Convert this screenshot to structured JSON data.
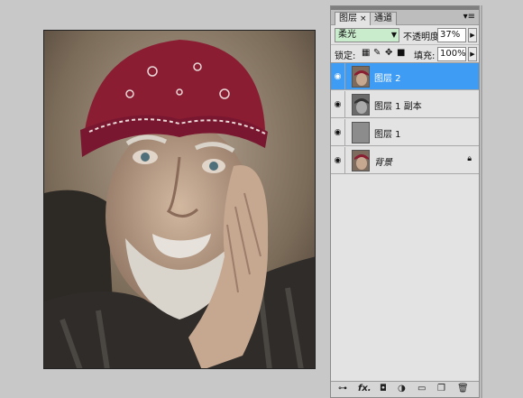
{
  "panel": {
    "tabs": [
      {
        "label": "图层",
        "close": "×"
      },
      {
        "label": "通道"
      }
    ],
    "menu_icon": "panel-menu-icon",
    "blend_mode": "柔光",
    "opacity_label": "不透明度:",
    "opacity_value": "37%",
    "lock_label": "锁定:",
    "fill_label": "填充:",
    "fill_value": "100%",
    "layers": [
      {
        "name": "图层 2",
        "selected": true,
        "visible": true
      },
      {
        "name": "图层 1 副本",
        "selected": false,
        "visible": true
      },
      {
        "name": "图层 1",
        "selected": false,
        "visible": true
      },
      {
        "name": "背景",
        "selected": false,
        "visible": true,
        "locked": true
      }
    ],
    "bottom_icons": [
      "link-icon",
      "fx-icon",
      "mask-icon",
      "adjustment-icon",
      "group-icon",
      "new-layer-icon",
      "trash-icon"
    ],
    "bottom_labels": {
      "fx": "fx."
    }
  },
  "colors": {
    "selection": "#3f9cf5",
    "blend_bg": "#c9eccc",
    "bandana": "#8b1d33"
  }
}
